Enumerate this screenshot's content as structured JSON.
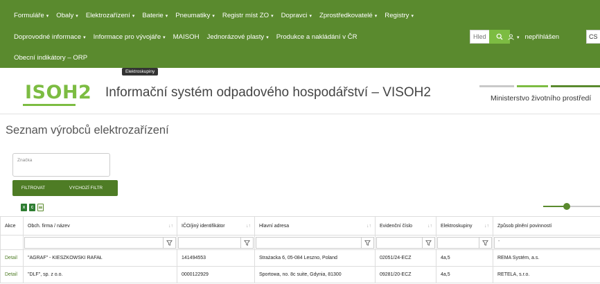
{
  "nav": {
    "row1": [
      {
        "label": "Formuláře",
        "caret": "▾"
      },
      {
        "label": "Obaly",
        "caret": "▾"
      },
      {
        "label": "Elektrozařízení",
        "caret": "▾"
      },
      {
        "label": "Baterie",
        "caret": "▾"
      },
      {
        "label": "Pneumatiky",
        "caret": "▾"
      },
      {
        "label": "Registr míst ZO",
        "caret": "▾"
      },
      {
        "label": "Dopravci",
        "caret": "▾"
      },
      {
        "label": "Zprostředkovatelé",
        "caret": "▾"
      },
      {
        "label": "Registry",
        "caret": "▾"
      }
    ],
    "row2": [
      {
        "label": "Doprovodné informace",
        "caret": "▾"
      },
      {
        "label": "Informace pro vývojáře",
        "caret": "▾"
      },
      {
        "label": "MAISOH",
        "caret": ""
      },
      {
        "label": "Jednorázové plasty",
        "caret": "▾"
      },
      {
        "label": "Produkce a nakládání v ČR",
        "caret": ""
      }
    ],
    "row3": [
      {
        "label": "Obecní indikátory – ORP",
        "caret": ""
      }
    ],
    "search_placeholder": "Hledat",
    "user_label": "nepřihlášen",
    "user_caret": "▾",
    "language": "CS",
    "tooltip": "Elektroskupiny"
  },
  "brand": {
    "logo": "ISOH2",
    "title": "Informační systém odpadového hospodářství – VISOH2",
    "ministry": "Ministerstvo životního prostředí"
  },
  "page": {
    "title": "Seznam výrobců elektrozařízení",
    "filter_label": "Značka",
    "filter_button": "FILTROVAT",
    "default_filter_button": "VYCHOZÍ FILTR"
  },
  "table": {
    "headers": [
      "Akce",
      "Obch. firma / název",
      "IČO/jiný identifikátor",
      "Hlavní adresa",
      "Evidenční číslo",
      "Elektroskupiny",
      "Způsob plnění povinností"
    ],
    "sort_icon": "↓↑",
    "select_placeholder": "-",
    "select_chevron": "⌄",
    "rows": [
      {
        "action": "Detail",
        "name": "\"AGRAF\" - KIESZKOWSKI RAFAŁ",
        "ico": "141494553",
        "address": "Strażacka 6, 05-084 Leszno, Poland",
        "evid": "02051/24-ECZ",
        "groups": "4a,5",
        "method": "REMA Systém, a.s."
      },
      {
        "action": "Detail",
        "name": "\"DLF\", sp. z o.o.",
        "ico": "0000122929",
        "address": "Sportowa, no. 8c suite, Gdynia, 81300",
        "evid": "09281/20-ECZ",
        "groups": "4a,5",
        "method": "RETELA, s.r.o."
      }
    ]
  },
  "colors": {
    "nav_bg": "#5a8a2e",
    "accent": "#7cbc42",
    "button_bg": "#4e7c25",
    "link": "#4e7c25"
  },
  "zoom_slider_fraction": 0.42
}
